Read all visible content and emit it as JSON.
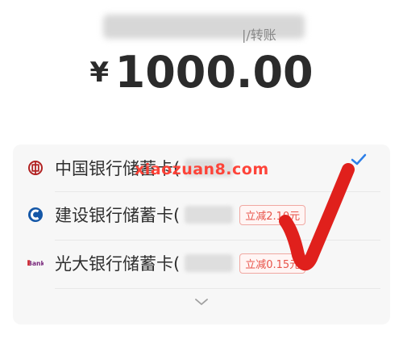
{
  "header": {
    "partial_text": "|/转账"
  },
  "payment": {
    "currency_symbol": "¥",
    "amount": "1000.00"
  },
  "accounts": {
    "items": [
      {
        "label": "中国银行储蓄卡(",
        "icon": "boc-icon",
        "selected": true,
        "promo": ""
      },
      {
        "label": "建设银行储蓄卡(",
        "icon": "ccb-icon",
        "selected": false,
        "promo": "立减2.10元"
      },
      {
        "label": "光大银行储蓄卡(",
        "icon": "ceb-icon",
        "selected": false,
        "promo": "立减0.15元"
      }
    ]
  },
  "overlays": {
    "watermark": "xiaozuan8.com"
  },
  "colors": {
    "text": "#2f2f2f",
    "check_blue": "#2d7fe8",
    "promo_red": "#e8544a",
    "watermark_red": "#ff3b30",
    "annotation_red": "#e0201c"
  }
}
